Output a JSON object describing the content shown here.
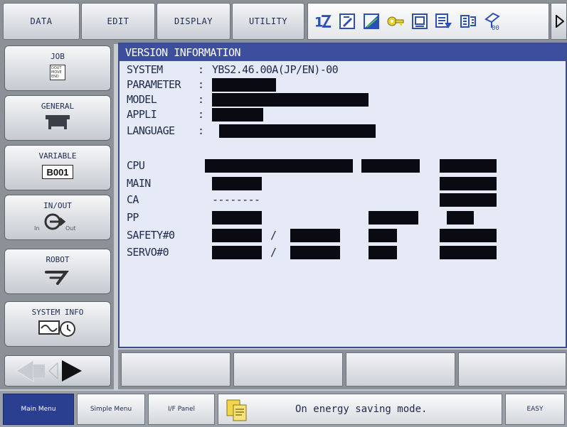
{
  "top_menu": {
    "data_label": "DATA",
    "edit_label": "EDIT",
    "display_label": "DISPLAY",
    "utility_label": "UTILITY"
  },
  "status_icons": [
    "cycle-mode-icon",
    "edit-lock-icon",
    "signal-bars-icon",
    "key-icon",
    "memory-icon",
    "teach-mode-icon",
    "coordinate-icon",
    "tool-number-icon"
  ],
  "left_nav": {
    "job_label": "JOB",
    "job_icon_text": [
      "DOUT",
      "MOVE",
      "END"
    ],
    "general_label": "GENERAL",
    "variable_label": "VARIABLE",
    "variable_icon_text": "B001",
    "inout_label": "IN/OUT",
    "inout_icon_in": "In",
    "inout_icon_out": "Out",
    "robot_label": "ROBOT",
    "system_info_label": "SYSTEM INFO"
  },
  "main": {
    "title": "VERSION INFORMATION",
    "rows": [
      {
        "label": "SYSTEM",
        "sep": ":",
        "value": "YBS2.46.00A(JP/EN)-00"
      },
      {
        "label": "PARAMETER",
        "sep": ":"
      },
      {
        "label": "MODEL",
        "sep": ":"
      },
      {
        "label": "APPLI",
        "sep": ":"
      },
      {
        "label": "LANGUAGE",
        "sep": ":"
      }
    ],
    "units": [
      {
        "label": "CPU"
      },
      {
        "label": "MAIN"
      },
      {
        "label": "CA",
        "value": "--------"
      },
      {
        "label": "PP"
      },
      {
        "label": "SAFETY#0",
        "sep": "/"
      },
      {
        "label": "SERVO#0",
        "sep": "/"
      }
    ]
  },
  "bottom": {
    "main_menu_label": "Main Menu",
    "simple_menu_label": "Simple Menu",
    "if_panel_label": "I/F Panel",
    "message": "On energy saving mode.",
    "easy_label": "EASY"
  },
  "colors": {
    "title_bar": "#3d4f9c",
    "panel_bg": "#e5eaf6",
    "main_menu_bg": "#2a3f8f",
    "redaction": "#0a0a12"
  }
}
